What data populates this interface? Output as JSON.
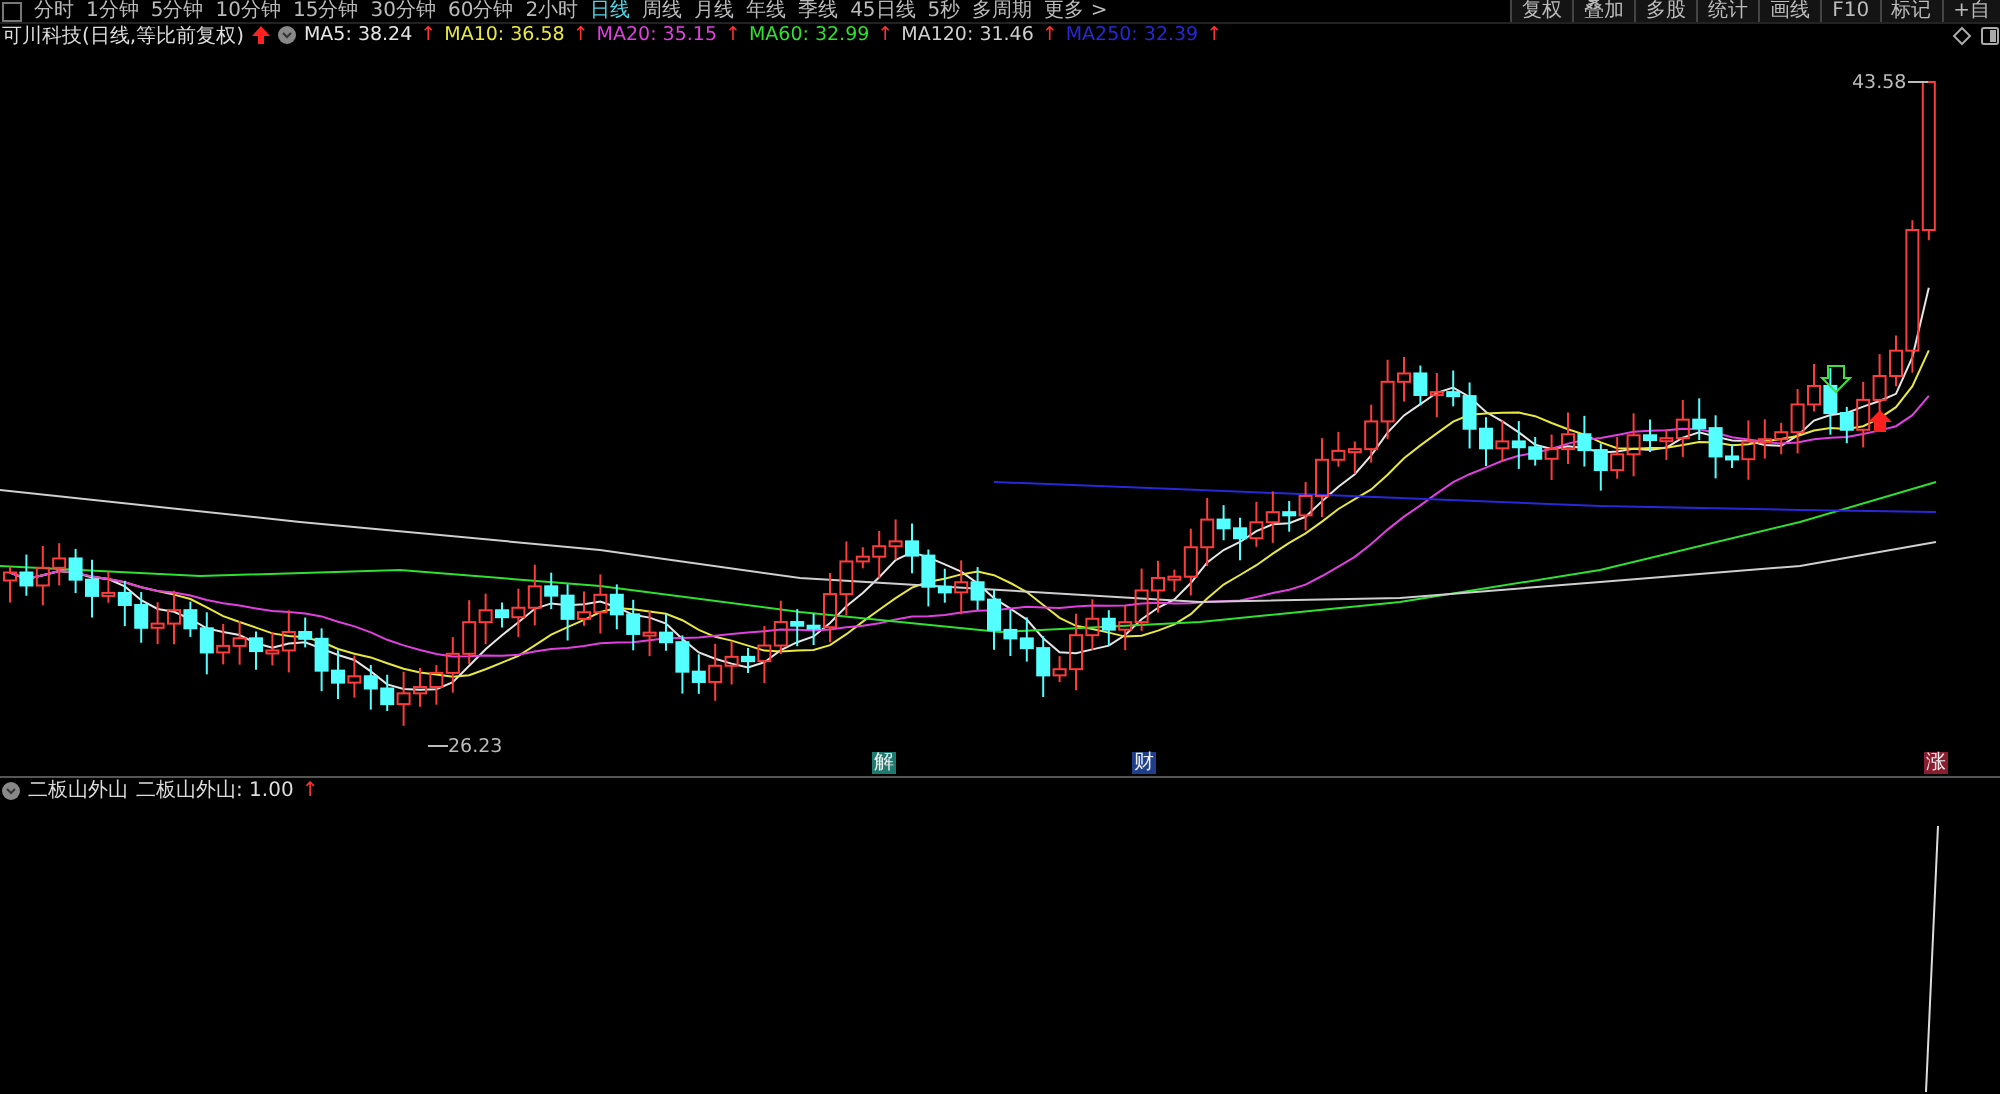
{
  "toolbar": {
    "periods": [
      {
        "label": "分时",
        "selected": false
      },
      {
        "label": "1分钟",
        "selected": false
      },
      {
        "label": "5分钟",
        "selected": false
      },
      {
        "label": "10分钟",
        "selected": false
      },
      {
        "label": "15分钟",
        "selected": false
      },
      {
        "label": "30分钟",
        "selected": false
      },
      {
        "label": "60分钟",
        "selected": false
      },
      {
        "label": "2小时",
        "selected": false
      },
      {
        "label": "日线",
        "selected": true
      },
      {
        "label": "周线",
        "selected": false
      },
      {
        "label": "月线",
        "selected": false
      },
      {
        "label": "年线",
        "selected": false
      },
      {
        "label": "季线",
        "selected": false
      },
      {
        "label": "45日线",
        "selected": false
      },
      {
        "label": "5秒",
        "selected": false
      },
      {
        "label": "多周期",
        "selected": false
      },
      {
        "label": "更多 >",
        "selected": false
      }
    ],
    "buttons": [
      "复权",
      "叠加",
      "多股",
      "统计",
      "画线",
      "F10",
      "标记",
      "+自"
    ]
  },
  "main_chart": {
    "title": "可川科技(日线,等比前复权)",
    "indicators": [
      {
        "label": "MA5: 38.24",
        "trend": "↑",
        "color": "#e6e6e6"
      },
      {
        "label": "MA10: 36.58",
        "trend": "↑",
        "color": "#e8e840"
      },
      {
        "label": "MA20: 35.15",
        "trend": "↑",
        "color": "#e040e0"
      },
      {
        "label": "MA60: 32.99",
        "trend": "↑",
        "color": "#30e030"
      },
      {
        "label": "MA120: 31.46",
        "trend": "↑",
        "color": "#cfcfcf"
      },
      {
        "label": "MA250: 32.39",
        "trend": "↑",
        "color": "#2828d8"
      }
    ],
    "high_label": "43.58",
    "low_label": "26.23",
    "event_marks": [
      {
        "label": "解",
        "color": "#1f7a70"
      },
      {
        "label": "财",
        "color": "#1d3f8c"
      },
      {
        "label": "涨",
        "color": "#8a1e30"
      }
    ]
  },
  "sub_chart": {
    "name": "二板山外山",
    "value": "二板山外山: 1.00",
    "trend": "↑"
  }
}
